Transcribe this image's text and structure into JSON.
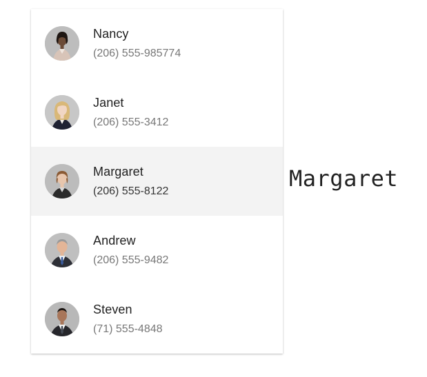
{
  "contacts": [
    {
      "name": "Nancy",
      "phone": "(206) 555-985774",
      "avatar": "avatar-nancy"
    },
    {
      "name": "Janet",
      "phone": "(206) 555-3412",
      "avatar": "avatar-janet"
    },
    {
      "name": "Margaret",
      "phone": "(206) 555-8122",
      "avatar": "avatar-margaret"
    },
    {
      "name": "Andrew",
      "phone": "(206) 555-9482",
      "avatar": "avatar-andrew"
    },
    {
      "name": "Steven",
      "phone": "(71) 555-4848",
      "avatar": "avatar-steven"
    }
  ],
  "selected_index": 2,
  "selection_readout": "Margaret",
  "colors": {
    "selected_row_bg": "#f3f3f3",
    "name_text": "#212121",
    "phone_text": "#777777",
    "avatar_bg": "#bdbdbd"
  }
}
